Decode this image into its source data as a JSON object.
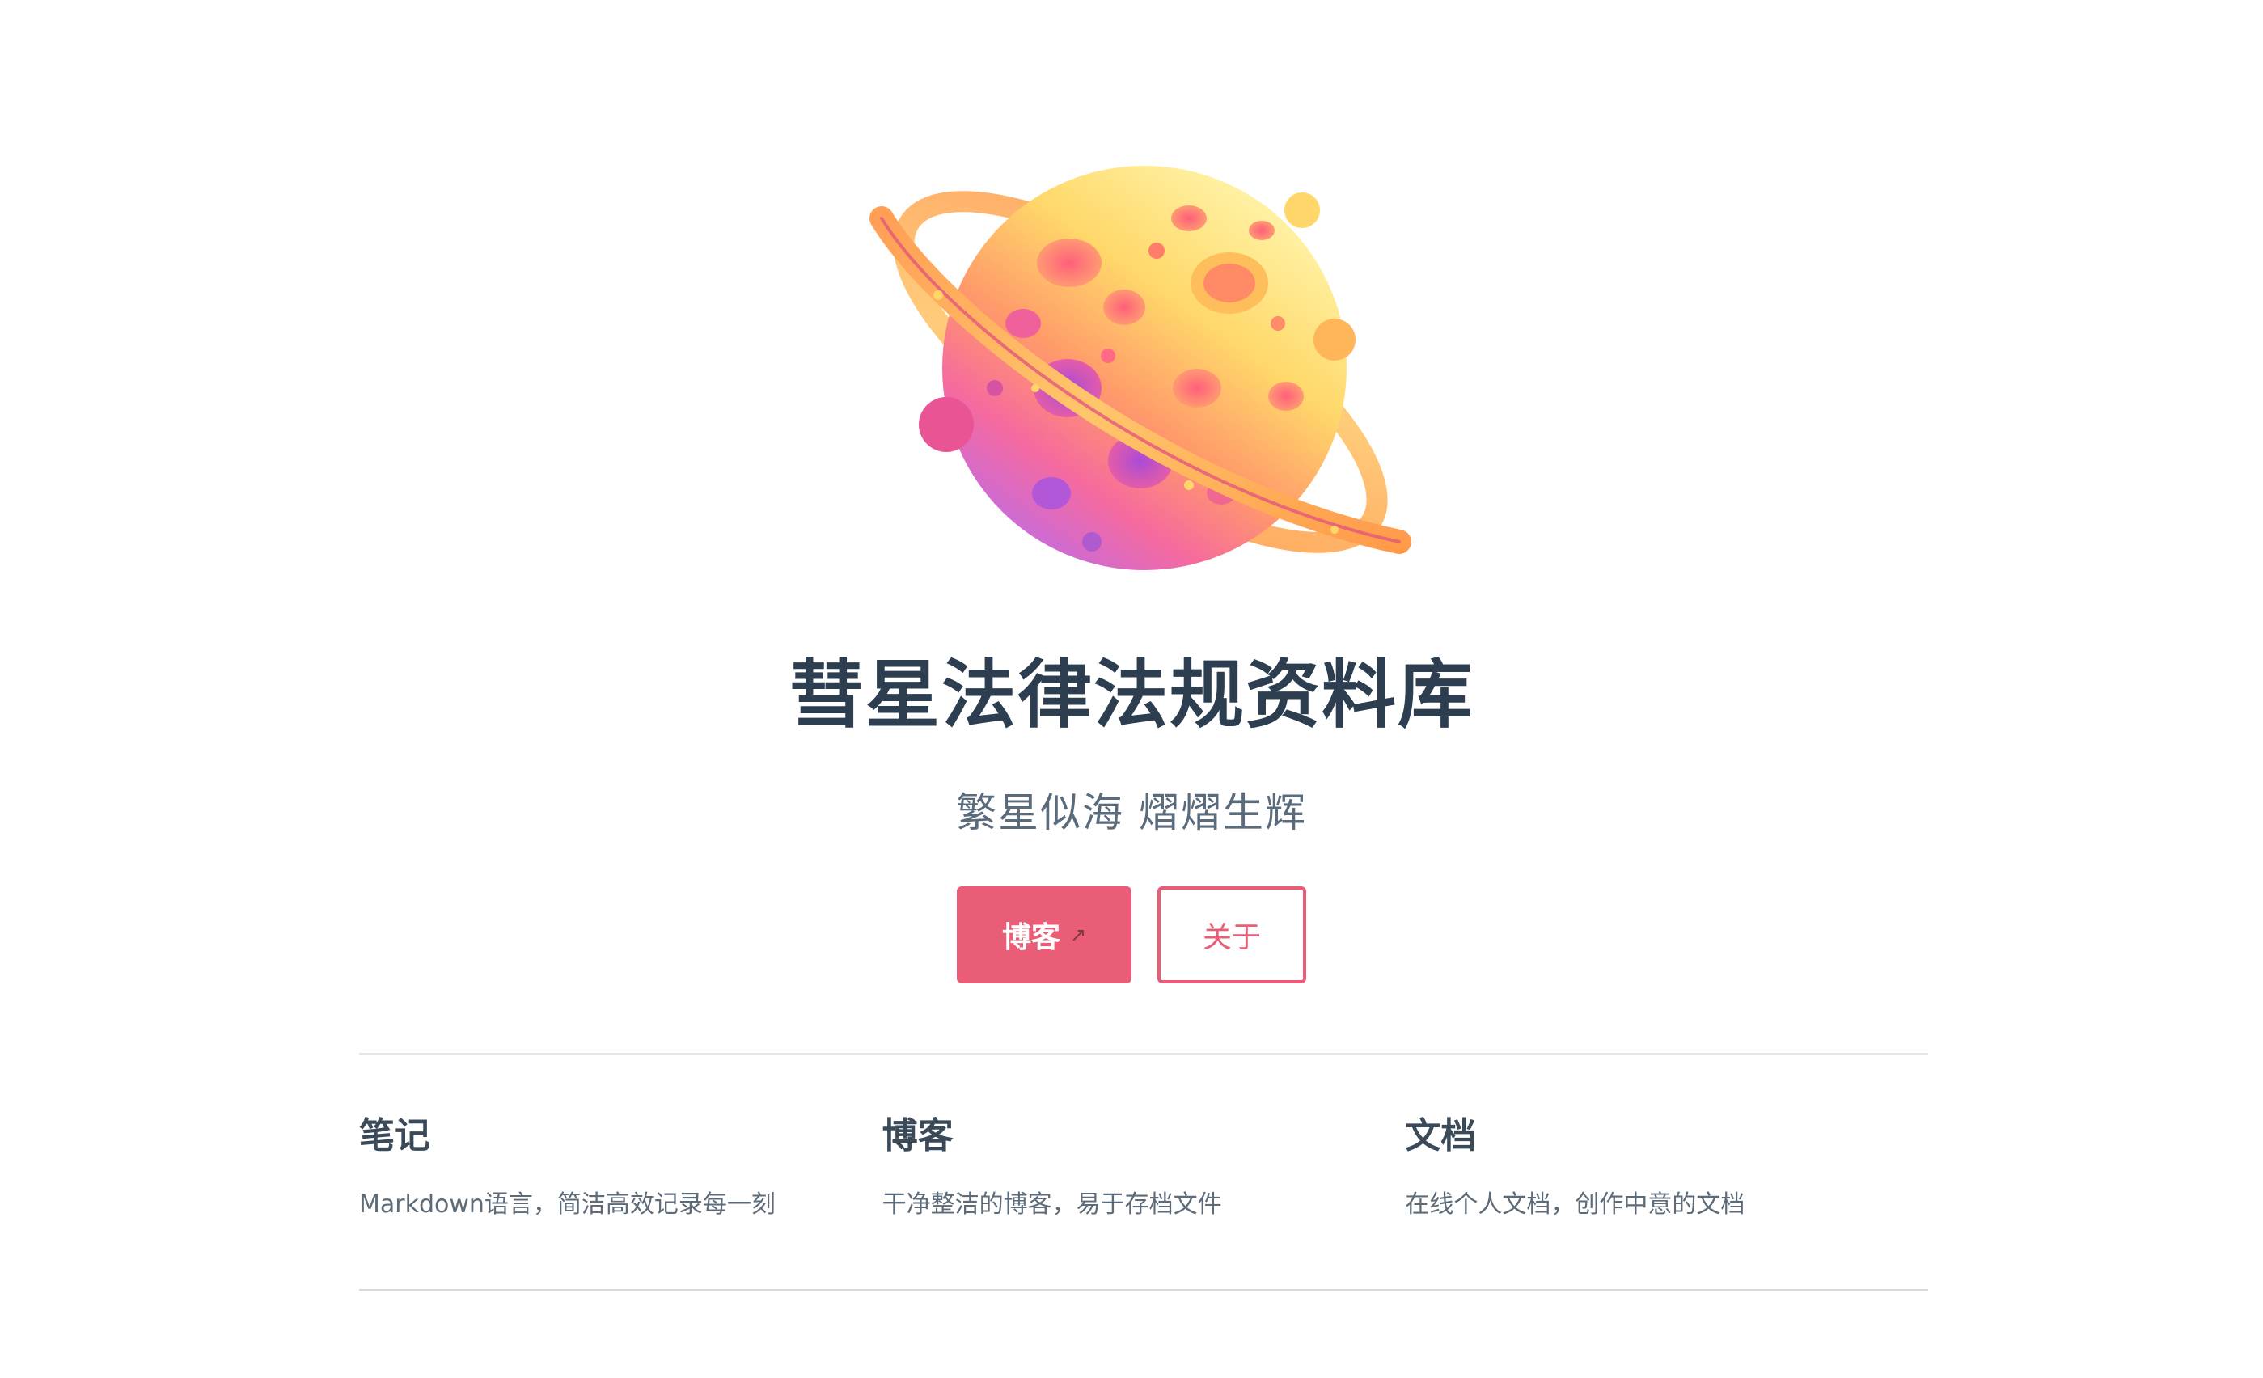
{
  "hero": {
    "image_icon": "ringed-planet-illustration",
    "title": "彗星法律法规资料库",
    "tagline": "繁星似海 熠熠生辉",
    "actions": [
      {
        "label": "博客",
        "icon": "external-link-icon",
        "icon_glyph": "↗"
      },
      {
        "label": "关于"
      }
    ]
  },
  "features": [
    {
      "title": "笔记",
      "details": "Markdown语言，简洁高效记录每一刻"
    },
    {
      "title": "博客",
      "details": "干净整洁的博客，易于存档文件"
    },
    {
      "title": "文档",
      "details": "在线个人文档，创作中意的文档"
    }
  ],
  "colors": {
    "accent": "#ea5d77",
    "title": "#2c3e50",
    "text": "#5d6b78",
    "divider": "#e4e7ea"
  }
}
